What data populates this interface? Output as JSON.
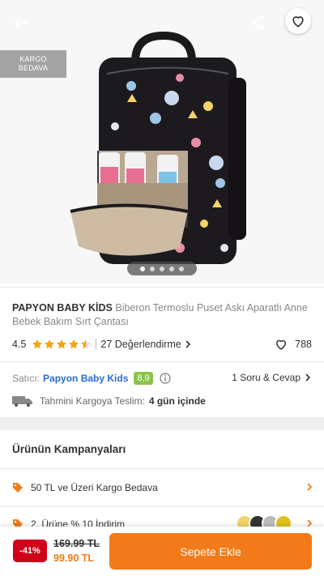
{
  "gallery": {
    "cargo_badge_line1": "KARGO",
    "cargo_badge_line2": "BEDAVA",
    "image_count": 5,
    "active_image": 1
  },
  "product": {
    "brand": "PAPYON BABY KİDS",
    "name": "Biberon Termoslu Puset Askı Aparatlı Anne Bebek Bakım Sırt Çantası"
  },
  "rating": {
    "score": "4.5",
    "stars": 4.5,
    "reviews_label": "27 Değerlendirme",
    "likes": "788"
  },
  "seller": {
    "label": "Satıcı:",
    "name": "Papyon Baby Kids",
    "score": "8,9",
    "qa_label": "1 Soru & Cevap"
  },
  "shipping": {
    "label": "Tahmini Kargoya Teslim:",
    "days": "4 gün içinde"
  },
  "campaigns": {
    "title": "Ürünün Kampanyaları",
    "items": [
      {
        "label": "50 TL ve Üzeri Kargo Bedava"
      },
      {
        "label": "2. Ürüne % 10 İndirim"
      }
    ]
  },
  "purchase": {
    "discount": "-41%",
    "old_price": "169.99 TL",
    "new_price": "99.90 TL",
    "add_to_cart": "Sepete Ekle"
  },
  "colors": {
    "accent": "#f27a1a",
    "seller_link": "#2a6bd4",
    "score_badge": "#8bc34a",
    "discount_badge": "#d0021b",
    "star": "#f7a300"
  },
  "icons": [
    "back-arrow-icon",
    "share-icon",
    "heart-icon",
    "star-icon",
    "chevron-right-icon",
    "info-icon",
    "truck-icon",
    "tag-icon"
  ]
}
